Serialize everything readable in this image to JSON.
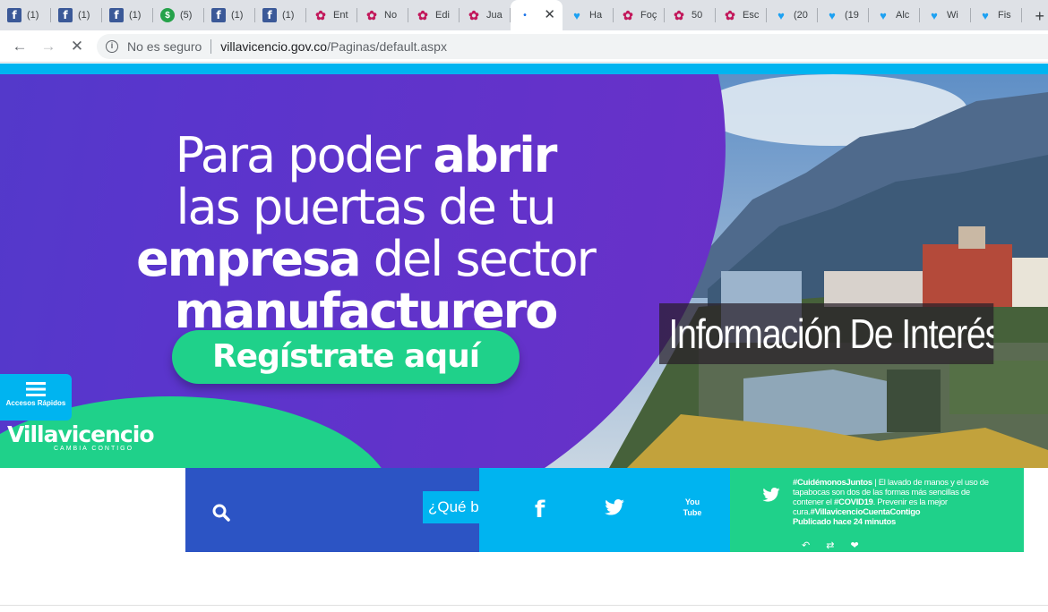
{
  "browser": {
    "tabs": [
      {
        "icon": "facebook-icon",
        "title": "(1)"
      },
      {
        "icon": "facebook-icon",
        "title": "(1)"
      },
      {
        "icon": "facebook-icon",
        "title": "(1)"
      },
      {
        "icon": "whatsapp-icon",
        "title": "(5)"
      },
      {
        "icon": "facebook-icon",
        "title": "(1)"
      },
      {
        "icon": "facebook-icon",
        "title": "(1)"
      },
      {
        "icon": "orchid-icon",
        "title": "Ent"
      },
      {
        "icon": "orchid-icon",
        "title": "No"
      },
      {
        "icon": "orchid-icon",
        "title": "Edi"
      },
      {
        "icon": "orchid-icon",
        "title": "Jua"
      },
      {
        "icon": "loading-icon",
        "title": "",
        "active": true
      },
      {
        "icon": "twitter-icon",
        "title": "Ha"
      },
      {
        "icon": "orchid-icon",
        "title": "Foç"
      },
      {
        "icon": "orchid-icon",
        "title": "50"
      },
      {
        "icon": "orchid-icon",
        "title": "Esc"
      },
      {
        "icon": "twitter-icon",
        "title": "(20"
      },
      {
        "icon": "twitter-icon",
        "title": "(19"
      },
      {
        "icon": "twitter-icon",
        "title": "Alc"
      },
      {
        "icon": "twitter-icon",
        "title": "Wi"
      },
      {
        "icon": "twitter-icon",
        "title": "Fis"
      }
    ],
    "security_label": "No es seguro",
    "url_host": "villavicencio.gov.co",
    "url_path": "/Paginas/default.aspx"
  },
  "hero": {
    "line1_light": "Para poder ",
    "line1_bold": "abrir",
    "line2_light": "las puertas de tu",
    "line3_bold": "empresa",
    "line3_light": " del sector",
    "line4_bold": "manufacturero",
    "cta_label": "Regístrate aquí",
    "info_banner": "Información De Interés",
    "colors": {
      "purple": "#5a35cc",
      "green": "#1fd18a",
      "cyan": "#00b4f0"
    }
  },
  "quick_access": {
    "label": "Accesos Rápidos"
  },
  "logo": {
    "name": "Villavicencio",
    "tagline": "CAMBIA CONTIGO"
  },
  "search": {
    "placeholder": "¿Qué buscas hacer hoy?"
  },
  "social": {
    "facebook": "f",
    "youtube": "You Tube"
  },
  "tweet": {
    "hashtag": "#CuidémonosJuntos",
    "text_part1": " | El lavado de manos y el uso de tapabocas son dos de las formas más sencillas de contener el ",
    "hashtag2": "#COVID19",
    "text_part2": ". Prevenir es la mejor cura.",
    "hashtag3": "#VillavicencioCuentaContigo",
    "published": "Publicado hace 24 minutos"
  }
}
